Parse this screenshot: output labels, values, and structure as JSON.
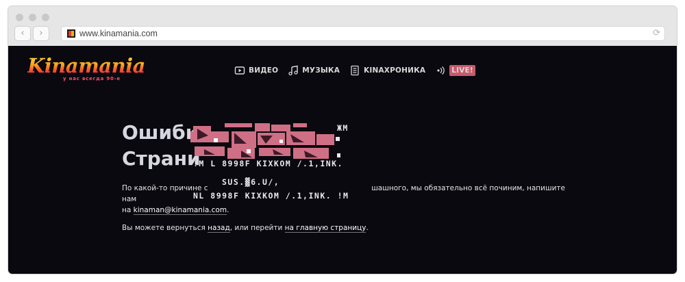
{
  "browser": {
    "url": "www.kinamania.com",
    "back_icon": "chevron-left-icon",
    "forward_icon": "chevron-right-icon",
    "reload_icon": "reload-icon"
  },
  "logo": {
    "title": "Kinamania",
    "subtitle": "у нас всегда 90-е"
  },
  "nav": [
    {
      "label": "ВИДЕО",
      "icon": "play-icon"
    },
    {
      "label": "МУЗЫКА",
      "icon": "music-note-icon"
    },
    {
      "label": "KINAХРОНИКА",
      "icon": "document-icon"
    },
    {
      "label": "LIVE!",
      "icon": "broadcast-icon"
    }
  ],
  "main": {
    "heading_line1": "Ошибк",
    "heading_line2": "Страни",
    "p1_text_a": "По какой-то причине с",
    "p1_text_b": "шашного, мы обязательно всё починим, напишите нам",
    "p1_text_c": "на ",
    "p1_email": "kinaman@kinamania.com",
    "p1_text_d": ".",
    "p2_text_a": "Вы можете вернуться ",
    "p2_link_back": "назад",
    "p2_text_b": ", или перейти ",
    "p2_link_home": "на главную страницу",
    "p2_text_c": "."
  },
  "glitch": {
    "line1": "!M L 8998F KIXKOM /.1,INK.",
    "line2": "SUS.▓6.U/,",
    "line3": "NL 8998F KIXKOM /.1,INK. !M",
    "top_right": "ЖМ"
  },
  "colors": {
    "page_bg": "#09090f",
    "heading": "#d6d7e0",
    "live_badge": "#c95a6a",
    "glitch_pink": "#cf6f86",
    "glitch_dark": "#3c1a28"
  }
}
